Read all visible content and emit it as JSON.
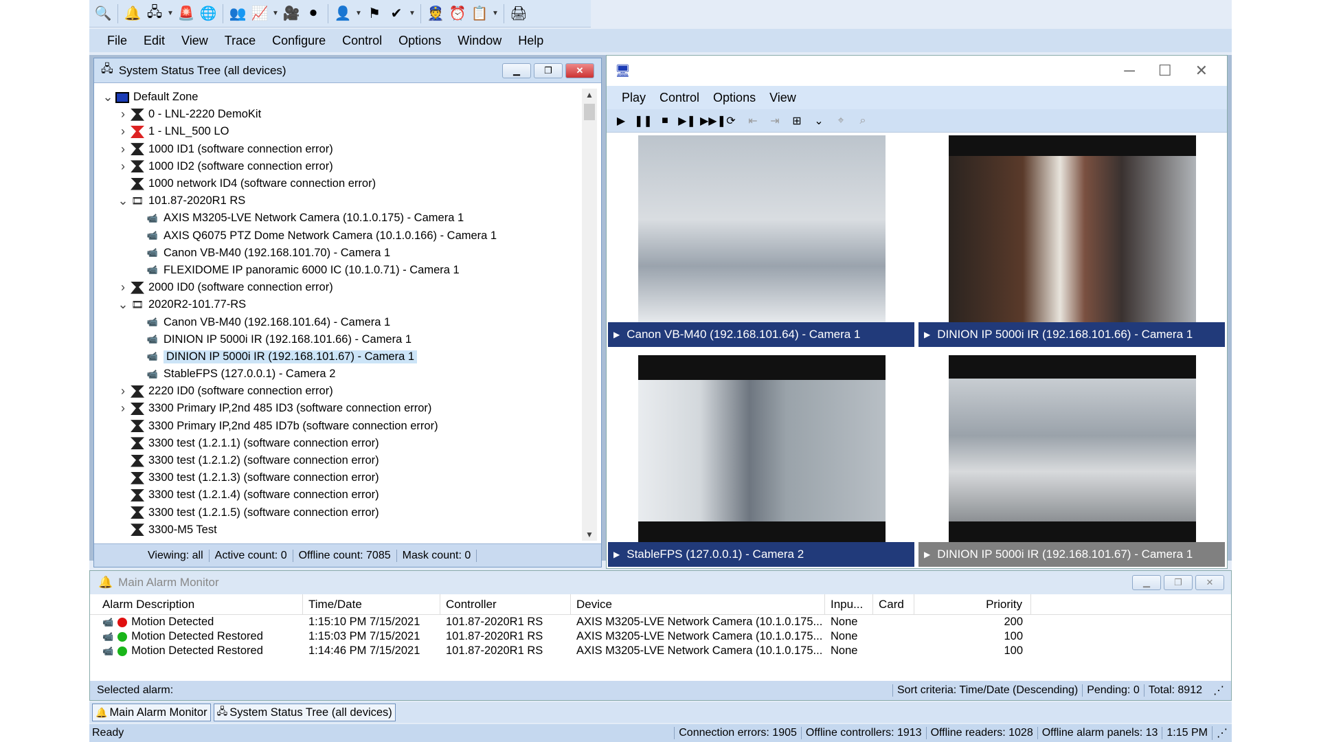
{
  "toolbar": {
    "icons": [
      "search-icon",
      "bell-icon",
      "tree-icon",
      "alarm-icon",
      "network-icon",
      "people-icon",
      "chart-icon",
      "camera-icon",
      "record-icon",
      "user-icon",
      "flag-icon",
      "check-icon",
      "guard-icon",
      "clock-icon",
      "report-icon",
      "printer-icon"
    ]
  },
  "menu": {
    "items": [
      "File",
      "Edit",
      "View",
      "Trace",
      "Configure",
      "Control",
      "Options",
      "Window",
      "Help"
    ]
  },
  "tree_window": {
    "title": "System Status Tree (all devices)",
    "rows": [
      {
        "text": "Default Zone",
        "level": 0,
        "expand": "v",
        "icon": "zone"
      },
      {
        "text": "0 - LNL-2220 DemoKit",
        "level": 1,
        "expand": ">",
        "icon": "ctrl"
      },
      {
        "text": "1 - LNL_500 LO",
        "level": 1,
        "expand": ">",
        "icon": "ctrl-red"
      },
      {
        "text": "1000 ID1 (software connection error)",
        "level": 1,
        "expand": ">",
        "icon": "ctrl"
      },
      {
        "text": "1000 ID2 (software connection error)",
        "level": 1,
        "expand": ">",
        "icon": "ctrl"
      },
      {
        "text": "1000 network ID4 (software connection error)",
        "level": 1,
        "expand": "",
        "icon": "ctrl"
      },
      {
        "text": "101.87-2020R1 RS",
        "level": 1,
        "expand": "v",
        "icon": "recorder"
      },
      {
        "text": "AXIS M3205-LVE Network Camera (10.1.0.175) - Camera 1",
        "level": 2,
        "expand": "",
        "icon": "cam"
      },
      {
        "text": "AXIS Q6075 PTZ Dome Network Camera (10.1.0.166) - Camera 1",
        "level": 2,
        "expand": "",
        "icon": "cam"
      },
      {
        "text": "Canon VB-M40 (192.168.101.70) - Camera 1",
        "level": 2,
        "expand": "",
        "icon": "cam"
      },
      {
        "text": "FLEXIDOME IP panoramic 6000 IC (10.1.0.71) - Camera 1",
        "level": 2,
        "expand": "",
        "icon": "cam"
      },
      {
        "text": "2000 ID0 (software connection error)",
        "level": 1,
        "expand": ">",
        "icon": "ctrl"
      },
      {
        "text": "2020R2-101.77-RS",
        "level": 1,
        "expand": "v",
        "icon": "recorder"
      },
      {
        "text": "Canon VB-M40 (192.168.101.64) - Camera 1",
        "level": 2,
        "expand": "",
        "icon": "cam"
      },
      {
        "text": "DINION IP 5000i IR (192.168.101.66) - Camera 1",
        "level": 2,
        "expand": "",
        "icon": "cam"
      },
      {
        "text": "DINION IP 5000i IR (192.168.101.67) - Camera 1",
        "level": 2,
        "expand": "",
        "icon": "cam",
        "selected": true
      },
      {
        "text": "StableFPS (127.0.0.1) - Camera 2",
        "level": 2,
        "expand": "",
        "icon": "cam"
      },
      {
        "text": "2220 ID0 (software connection error)",
        "level": 1,
        "expand": ">",
        "icon": "ctrl"
      },
      {
        "text": "3300 Primary IP,2nd 485 ID3 (software connection error)",
        "level": 1,
        "expand": ">",
        "icon": "ctrl"
      },
      {
        "text": "3300 Primary IP,2nd 485 ID7b (software connection error)",
        "level": 1,
        "expand": "",
        "icon": "ctrl"
      },
      {
        "text": "3300 test (1.2.1.1) (software connection error)",
        "level": 1,
        "expand": "",
        "icon": "ctrl"
      },
      {
        "text": "3300 test (1.2.1.2) (software connection error)",
        "level": 1,
        "expand": "",
        "icon": "ctrl"
      },
      {
        "text": "3300 test (1.2.1.3) (software connection error)",
        "level": 1,
        "expand": "",
        "icon": "ctrl"
      },
      {
        "text": "3300 test (1.2.1.4) (software connection error)",
        "level": 1,
        "expand": "",
        "icon": "ctrl"
      },
      {
        "text": "3300 test (1.2.1.5) (software connection error)",
        "level": 1,
        "expand": "",
        "icon": "ctrl"
      },
      {
        "text": "3300-M5 Test",
        "level": 1,
        "expand": "",
        "icon": "ctrl"
      }
    ],
    "status": {
      "viewing": "Viewing: all",
      "active": "Active count: 0",
      "offline": "Offline count: 7085",
      "mask": "Mask count: 0"
    }
  },
  "viewer": {
    "menu": [
      "Play",
      "Control",
      "Options",
      "View"
    ],
    "tools": [
      "▶",
      "❚❚",
      "■",
      "▶❚",
      "▶▶❚",
      "⟳",
      "⇤",
      "⇥",
      "⊞",
      "⌄",
      "⌖",
      "⌕"
    ],
    "cells": [
      {
        "label": "Canon VB-M40 (192.168.101.64) - Camera 1",
        "bar": "#213a7a"
      },
      {
        "label": "DINION IP 5000i IR (192.168.101.66) - Camera 1",
        "bar": "#213a7a"
      },
      {
        "label": "StableFPS (127.0.0.1) - Camera 2",
        "bar": "#213a7a"
      },
      {
        "label": "DINION IP 5000i IR (192.168.101.67) - Camera 1",
        "bar": "#808080"
      }
    ]
  },
  "alarm": {
    "title": "Main Alarm Monitor",
    "columns": [
      "Alarm Description",
      "Time/Date",
      "Controller",
      "Device",
      "Inpu...",
      "Card",
      "Priority"
    ],
    "rows": [
      {
        "desc": "Motion Detected",
        "color": "#e01010",
        "time": "1:15:10 PM  7/15/2021",
        "controller": "101.87-2020R1 RS",
        "device": "AXIS M3205-LVE Network Camera (10.1.0.175...",
        "input": "None",
        "card": "",
        "priority": "200"
      },
      {
        "desc": "Motion Detected Restored",
        "color": "#19b519",
        "time": "1:15:03 PM  7/15/2021",
        "controller": "101.87-2020R1 RS",
        "device": "AXIS M3205-LVE Network Camera (10.1.0.175...",
        "input": "None",
        "card": "",
        "priority": "100"
      },
      {
        "desc": "Motion Detected Restored",
        "color": "#19b519",
        "time": "1:14:46 PM  7/15/2021",
        "controller": "101.87-2020R1 RS",
        "device": "AXIS M3205-LVE Network Camera (10.1.0.175...",
        "input": "None",
        "card": "",
        "priority": "100"
      }
    ],
    "status": {
      "selected": "Selected alarm:",
      "sort": "Sort criteria: Time/Date (Descending)",
      "pending": "Pending: 0",
      "total": "Total: 8912"
    }
  },
  "tabs": [
    "Main Alarm Monitor",
    "System Status Tree (all devices)"
  ],
  "mainstatus": {
    "ready": "Ready",
    "conn": "Connection errors: 1905",
    "offctl": "Offline controllers: 1913",
    "offrd": "Offline readers: 1028",
    "offap": "Offline alarm panels: 13",
    "time": "1:15 PM"
  }
}
